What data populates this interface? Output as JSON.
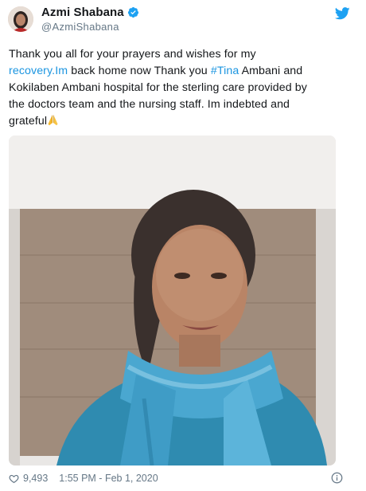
{
  "author": {
    "display_name": "Azmi Shabana",
    "handle": "@AzmiShabana"
  },
  "icons": {
    "verified": "verified-badge-icon",
    "brand": "twitter-bird-icon",
    "emoji": "folded-hands-emoji",
    "like": "heart-outline-icon",
    "info": "info-circle-icon"
  },
  "tweet": {
    "line1": "Thank you all for your prayers and wishes for my",
    "link1": "recovery.Im",
    "line2_after_link": " back home now Thank you ",
    "hashtag": "#Tina",
    "line2_end": " Ambani and",
    "line3": "Kokilaben Ambani hospital for the sterling care provided by",
    "line4": "the doctors team and the nursing staff. Im indebted and",
    "line5": "grateful"
  },
  "footer": {
    "likes": "9,493",
    "timestamp": "1:55 PM - Feb 1, 2020"
  },
  "colors": {
    "link": "#1b95e0",
    "brand": "#1da1f2",
    "muted": "#657786",
    "text": "#14171a"
  }
}
